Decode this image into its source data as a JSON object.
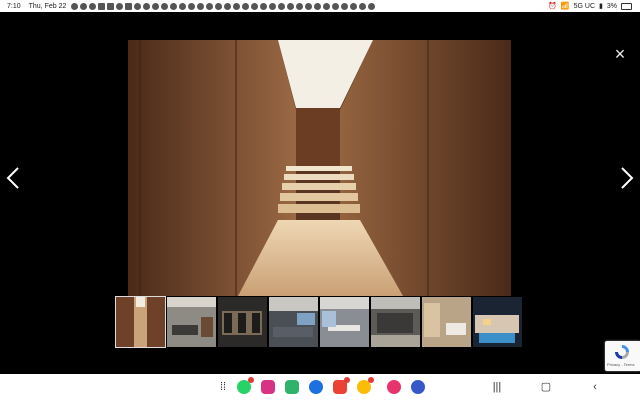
{
  "status_bar": {
    "time": "7:10",
    "date": "Thu, Feb 22",
    "network": "5G UC",
    "battery": "3%"
  },
  "gallery": {
    "close_glyph": "×",
    "prev_icon": "chevron-left-icon",
    "next_icon": "chevron-right-icon",
    "thumbnails": [
      {
        "active": true
      },
      {
        "active": false
      },
      {
        "active": false
      },
      {
        "active": false
      },
      {
        "active": false
      },
      {
        "active": false
      },
      {
        "active": false
      },
      {
        "active": false
      }
    ]
  },
  "recaptcha": {
    "terms": "Privacy - Terms"
  },
  "dock": {
    "apps": [
      "apps-grid-icon",
      "whatsapp-icon",
      "phone-icon",
      "green-app-icon",
      "messages-icon",
      "gmail-icon",
      "chrome-icon",
      "flower-app-icon",
      "settings-icon"
    ],
    "nav": [
      "recents-icon",
      "home-icon",
      "back-icon"
    ]
  },
  "colors": {
    "wood": "#7a4a2c",
    "floor": "#d9b48c",
    "light": "#f4efe4"
  }
}
